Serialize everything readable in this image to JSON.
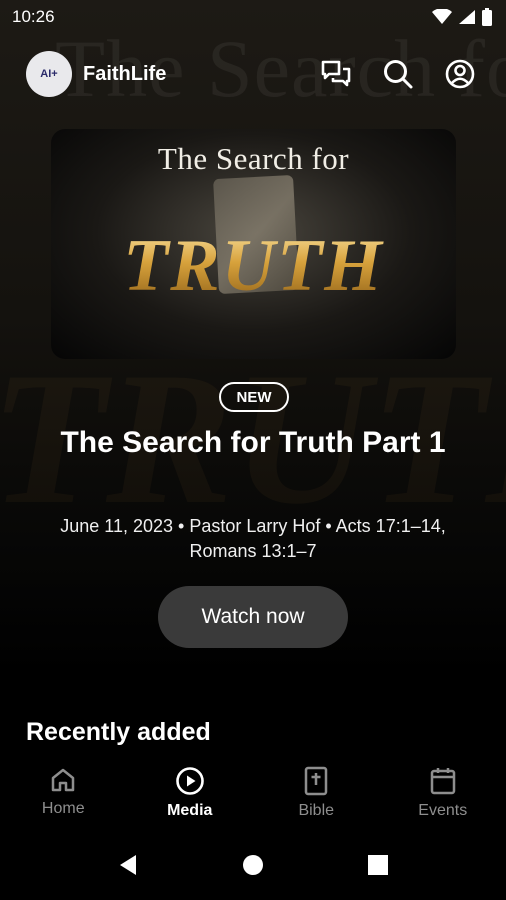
{
  "status_bar": {
    "time": "10:26"
  },
  "header": {
    "app_name": "FaithLife",
    "logo_text": "AI+"
  },
  "hero": {
    "art_top_text": "The Search for",
    "art_main_text": "TRUTH",
    "badge": "NEW",
    "title": "The Search for Truth Part 1",
    "meta": "June 11, 2023 • Pastor Larry Hof • Acts 17:1–14, Romans 13:1–7",
    "watch_label": "Watch now"
  },
  "sections": {
    "recent_title": "Recently added"
  },
  "bottom_nav": {
    "items": [
      {
        "label": "Home",
        "icon": "home-icon",
        "active": false
      },
      {
        "label": "Media",
        "icon": "play-icon",
        "active": true
      },
      {
        "label": "Bible",
        "icon": "bible-icon",
        "active": false
      },
      {
        "label": "Events",
        "icon": "calendar-icon",
        "active": false
      }
    ]
  },
  "colors": {
    "accent_gold": "#d7a23c",
    "inactive": "#8e8e8e",
    "button_bg": "#3a3a3a"
  }
}
